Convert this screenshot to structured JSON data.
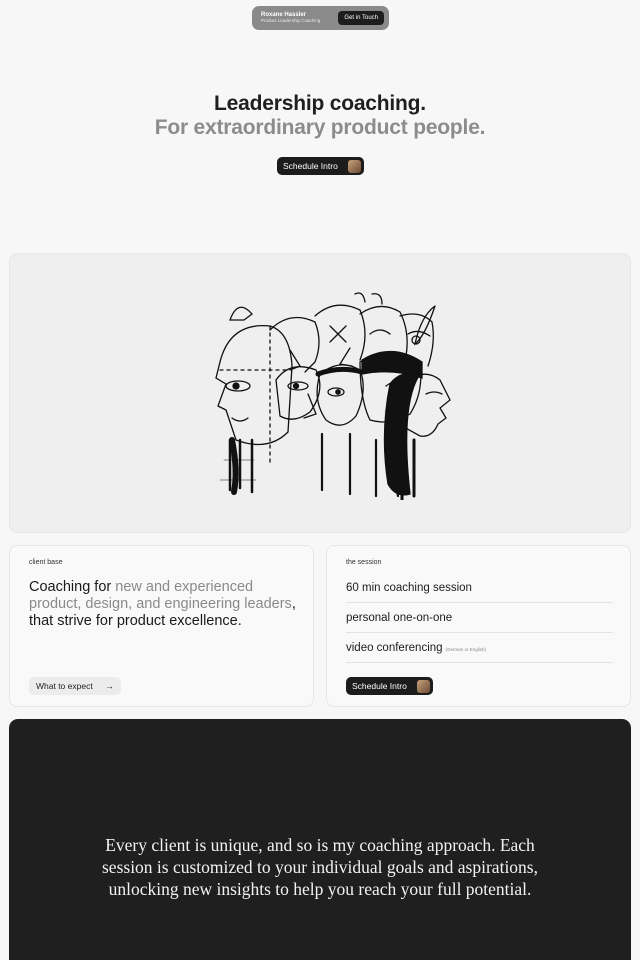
{
  "nav": {
    "brand_name": "Roxane Hassler",
    "brand_tagline": "Product Leadership Coaching",
    "cta_label": "Get in Touch"
  },
  "hero": {
    "title": "Leadership coaching.",
    "subtitle": "For extraordinary product people.",
    "schedule_label": "Schedule Intro"
  },
  "client_base": {
    "label": "client base",
    "text_part1": "Coaching for ",
    "text_part2": "new and experienced product, design, and engineering leaders",
    "text_part3": ", that strive for product excellence.",
    "button_label": "What to expect",
    "button_icon": "arrow-right-icon"
  },
  "session": {
    "label": "the session",
    "items": [
      {
        "text": "60 min coaching session",
        "note": ""
      },
      {
        "text": "personal one-on-one",
        "note": ""
      },
      {
        "text": "video conferencing",
        "note": "(German or English)"
      }
    ],
    "schedule_label": "Schedule Intro"
  },
  "quote": {
    "text": "Every client is unique, and so is my coaching approach. Each session is customized to your individual goals and aspirations, unlocking new insights to help you reach your full potential."
  },
  "colors": {
    "dark": "#1f1f1f",
    "muted_text": "#8c8c8c",
    "background": "#f7f7f7"
  }
}
